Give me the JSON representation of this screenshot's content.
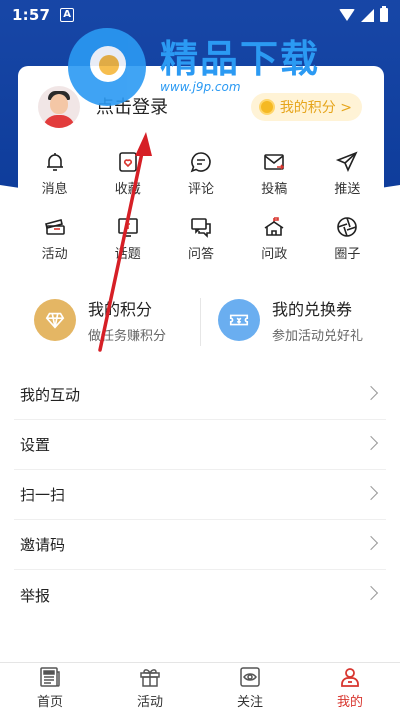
{
  "status_bar": {
    "time": "1:57",
    "notification_badge": "A"
  },
  "watermark": {
    "title": "精品下载",
    "url": "www.j9p.com"
  },
  "profile": {
    "login_text": "点击登录",
    "points_badge": "我的积分 >"
  },
  "grid": [
    {
      "label": "消息",
      "icon": "bell-icon"
    },
    {
      "label": "收藏",
      "icon": "bookmark-heart-icon"
    },
    {
      "label": "评论",
      "icon": "comment-icon"
    },
    {
      "label": "投稿",
      "icon": "mail-send-icon"
    },
    {
      "label": "推送",
      "icon": "send-icon"
    },
    {
      "label": "活动",
      "icon": "ticket-icon"
    },
    {
      "label": "话题",
      "icon": "topic-icon"
    },
    {
      "label": "问答",
      "icon": "qa-icon"
    },
    {
      "label": "问政",
      "icon": "government-icon"
    },
    {
      "label": "圈子",
      "icon": "aperture-icon"
    }
  ],
  "shortcuts": {
    "points": {
      "title": "我的积分",
      "subtitle": "做任务赚积分",
      "color": "#e4b664"
    },
    "vouchers": {
      "title": "我的兑换券",
      "subtitle": "参加活动兑好礼",
      "color": "#6aaef0"
    }
  },
  "menu": [
    "我的互动",
    "设置",
    "扫一扫",
    "邀请码",
    "举报"
  ],
  "tabs": [
    {
      "label": "首页",
      "icon": "news-icon",
      "active": false
    },
    {
      "label": "活动",
      "icon": "gift-icon",
      "active": false
    },
    {
      "label": "关注",
      "icon": "eye-icon",
      "active": false
    },
    {
      "label": "我的",
      "icon": "person-icon",
      "active": true
    }
  ],
  "colors": {
    "header_blue": "#0e3fa3",
    "accent_red": "#d8362f",
    "points_gold": "#e6a51c"
  }
}
